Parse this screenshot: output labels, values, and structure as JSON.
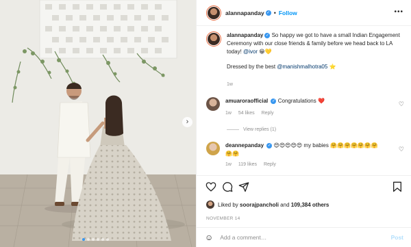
{
  "post": {
    "username": "alannapanday",
    "follow_label": "Follow",
    "separator": "•",
    "more_label": "•••",
    "caption": {
      "text_before": "So happy we got to have a small Indian Engagement Ceremony with our close friends & family before we head back to LA today!",
      "mention_1": "@ivor",
      "emojis_1": "😁💛",
      "text_line2": "Dressed by the best",
      "mention_2": "@manishmalhotra05",
      "emojis_2": "⭐",
      "time": "1w"
    },
    "comments": [
      {
        "username": "amuaroraofficial",
        "text": "Congratulations",
        "emoji": "❤️",
        "time": "1w",
        "likes": "54 likes",
        "reply": "Reply",
        "view_replies": "View replies (1)"
      },
      {
        "username": "deannepanday",
        "text": "😍😍😍😍😍 my babies 🤗🤗🤗🤗🤗🤗🤗🤗🤗",
        "time": "1w",
        "likes": "119 likes",
        "reply": "Reply"
      }
    ],
    "liked_by": {
      "prefix": "Liked by",
      "user": "soorajpancholi",
      "conj": "and",
      "count": "109,384 others"
    },
    "date": "NOVEMBER 14",
    "add_comment": {
      "placeholder": "Add a comment…",
      "post_label": "Post"
    },
    "carousel": {
      "dot_count": 6,
      "active_index": 0,
      "next_arrow": "›"
    }
  },
  "icons": {
    "heart": "heart-icon",
    "comment": "comment-icon",
    "share": "share-icon",
    "save": "bookmark-icon",
    "emoji": "emoji-icon",
    "verified": "verified-badge-icon"
  },
  "colors": {
    "accent_blue": "#0095f6",
    "verified_blue": "#3897f0",
    "secondary_text": "#8e8e8e",
    "post_disabled": "#b2dffc"
  }
}
